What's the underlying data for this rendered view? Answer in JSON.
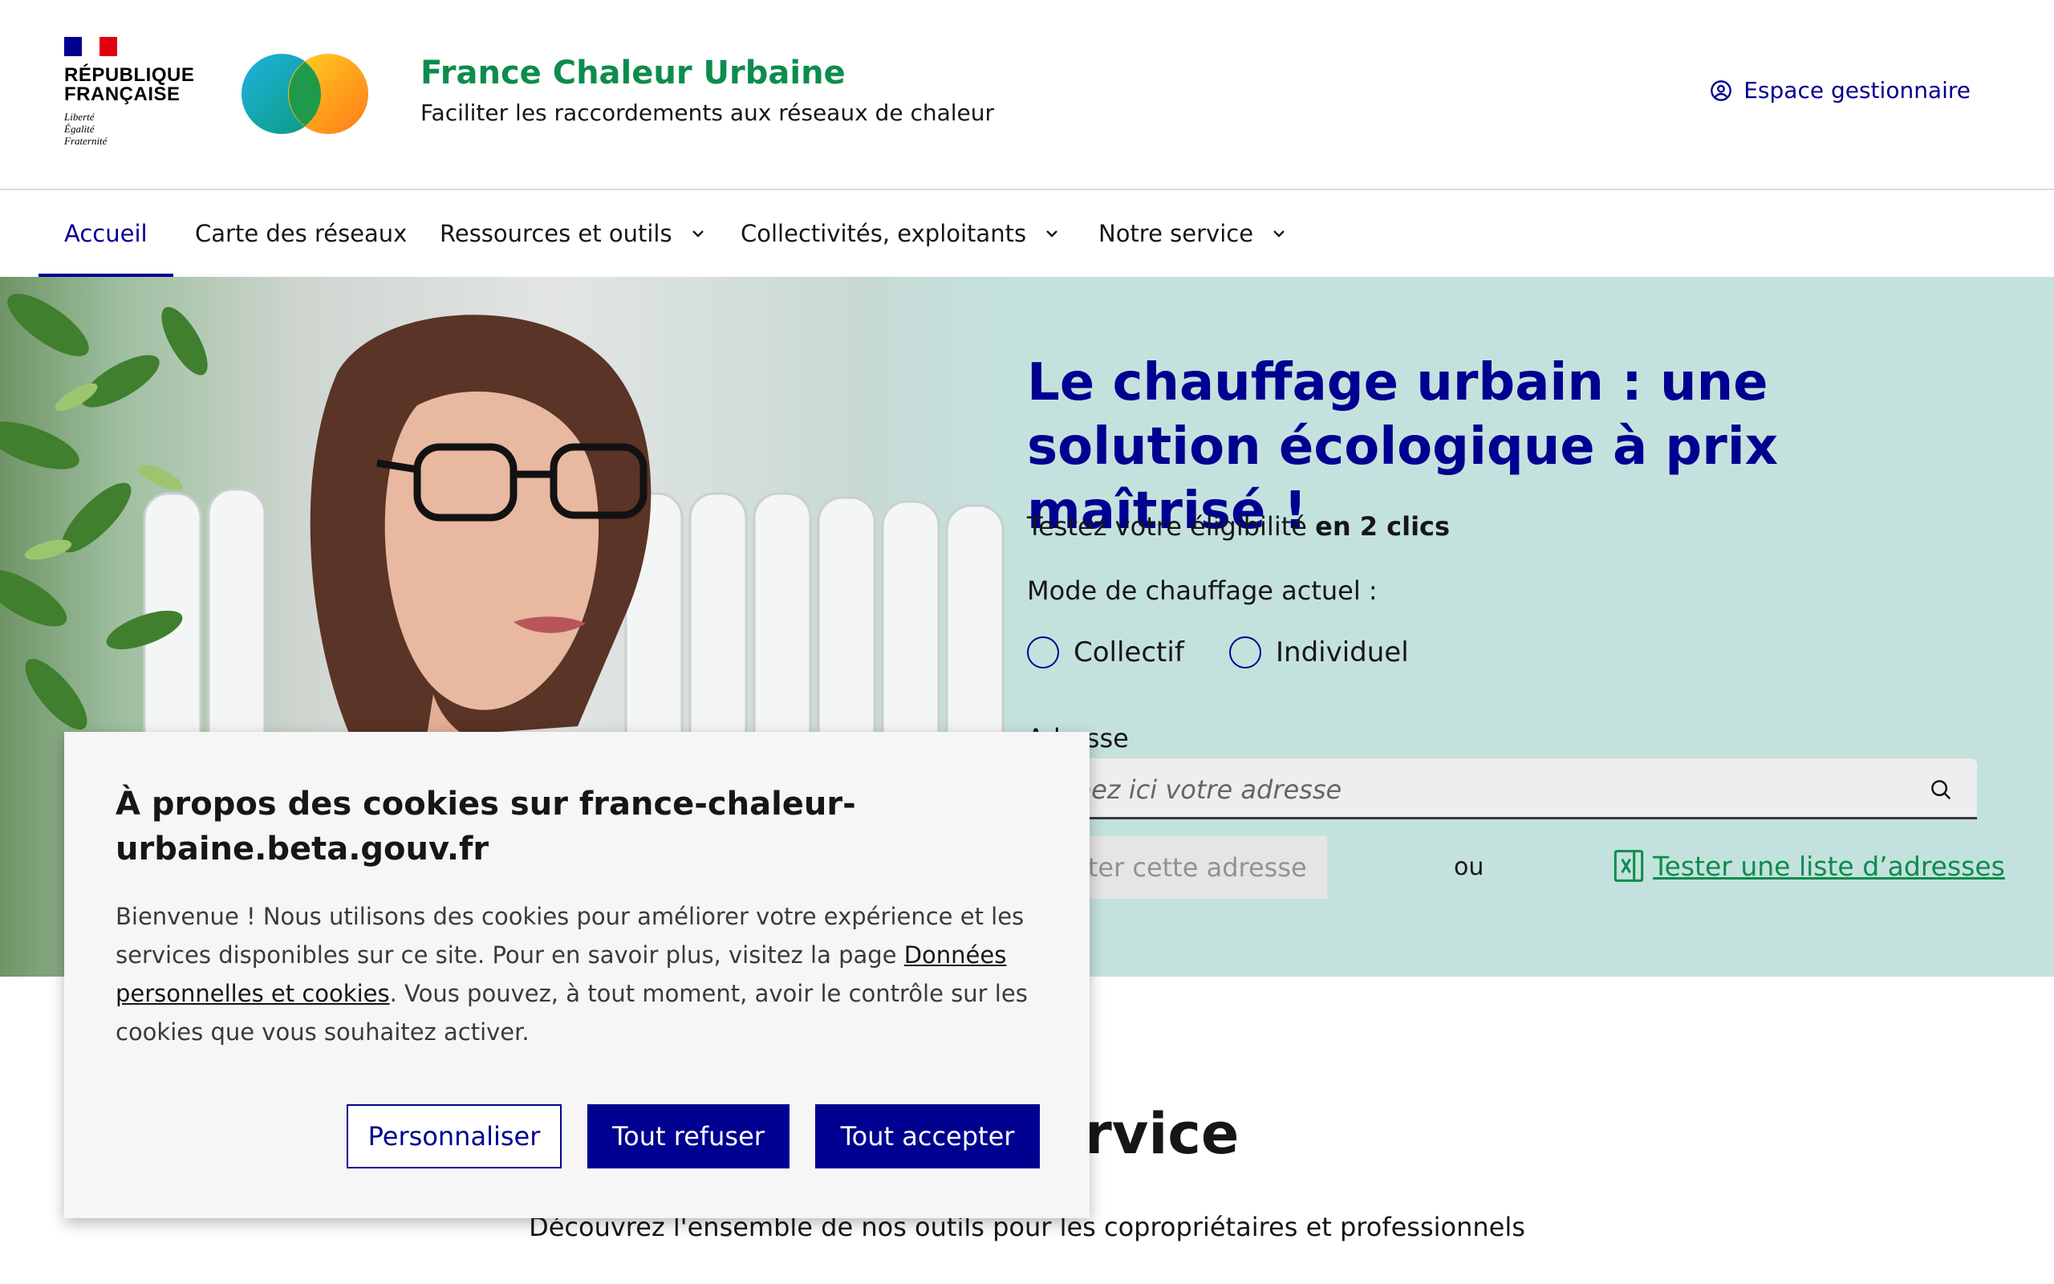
{
  "header": {
    "gov_block": [
      "RÉPUBLIQUE",
      "FRANÇAISE"
    ],
    "motto": [
      "Liberté",
      "Égalité",
      "Fraternité"
    ],
    "brand_title": "France Chaleur Urbaine",
    "brand_subtitle": "Faciliter les raccordements aux réseaux de chaleur",
    "account_link": "Espace gestionnaire",
    "account_icon": "user-circle-icon"
  },
  "nav": {
    "items": [
      {
        "label": "Accueil",
        "active": true
      },
      {
        "label": "Carte des réseaux"
      },
      {
        "label": "Ressources et outils",
        "dropdown": true
      },
      {
        "label": "Collectivités, exploitants",
        "dropdown": true
      },
      {
        "label": "Notre service",
        "dropdown": true
      }
    ]
  },
  "hero": {
    "title": "Le chauffage urbain : une solution écologique à prix maîtrisé !",
    "lead_prefix": "Testez votre éligibilité ",
    "lead_bold": "en 2 clics",
    "mode_label": "Mode de chauffage actuel :",
    "radio_options": [
      "Collectif",
      "Individuel"
    ],
    "address_label": "Adresse",
    "address_placeholder": "Tapez ici votre adresse",
    "test_button": "Tester cette adresse",
    "or_text": "ou",
    "list_link": "Tester une liste d’adresses"
  },
  "service": {
    "title": "Notre service",
    "subtitle": "Découvrez l'ensemble de nos outils pour les copropriétaires et professionnels"
  },
  "cookie": {
    "title": "À propos des cookies sur france-chaleur-urbaine.beta.gouv.fr",
    "text_before": "Bienvenue ! Nous utilisons des cookies pour améliorer votre expérience et les services disponibles sur ce site. Pour en savoir plus, visitez la page ",
    "link": "Données personnelles et cookies",
    "text_after": ".  Vous pouvez, à tout moment, avoir le contrôle sur les cookies que vous souhaitez activer.",
    "buttons": {
      "customize": "Personnaliser",
      "refuse": "Tout refuser",
      "accept": "Tout accepter"
    }
  },
  "colors": {
    "primary": "#000091",
    "brand_green": "#0c8c4d",
    "hero_bg": "#c4e2dd"
  }
}
